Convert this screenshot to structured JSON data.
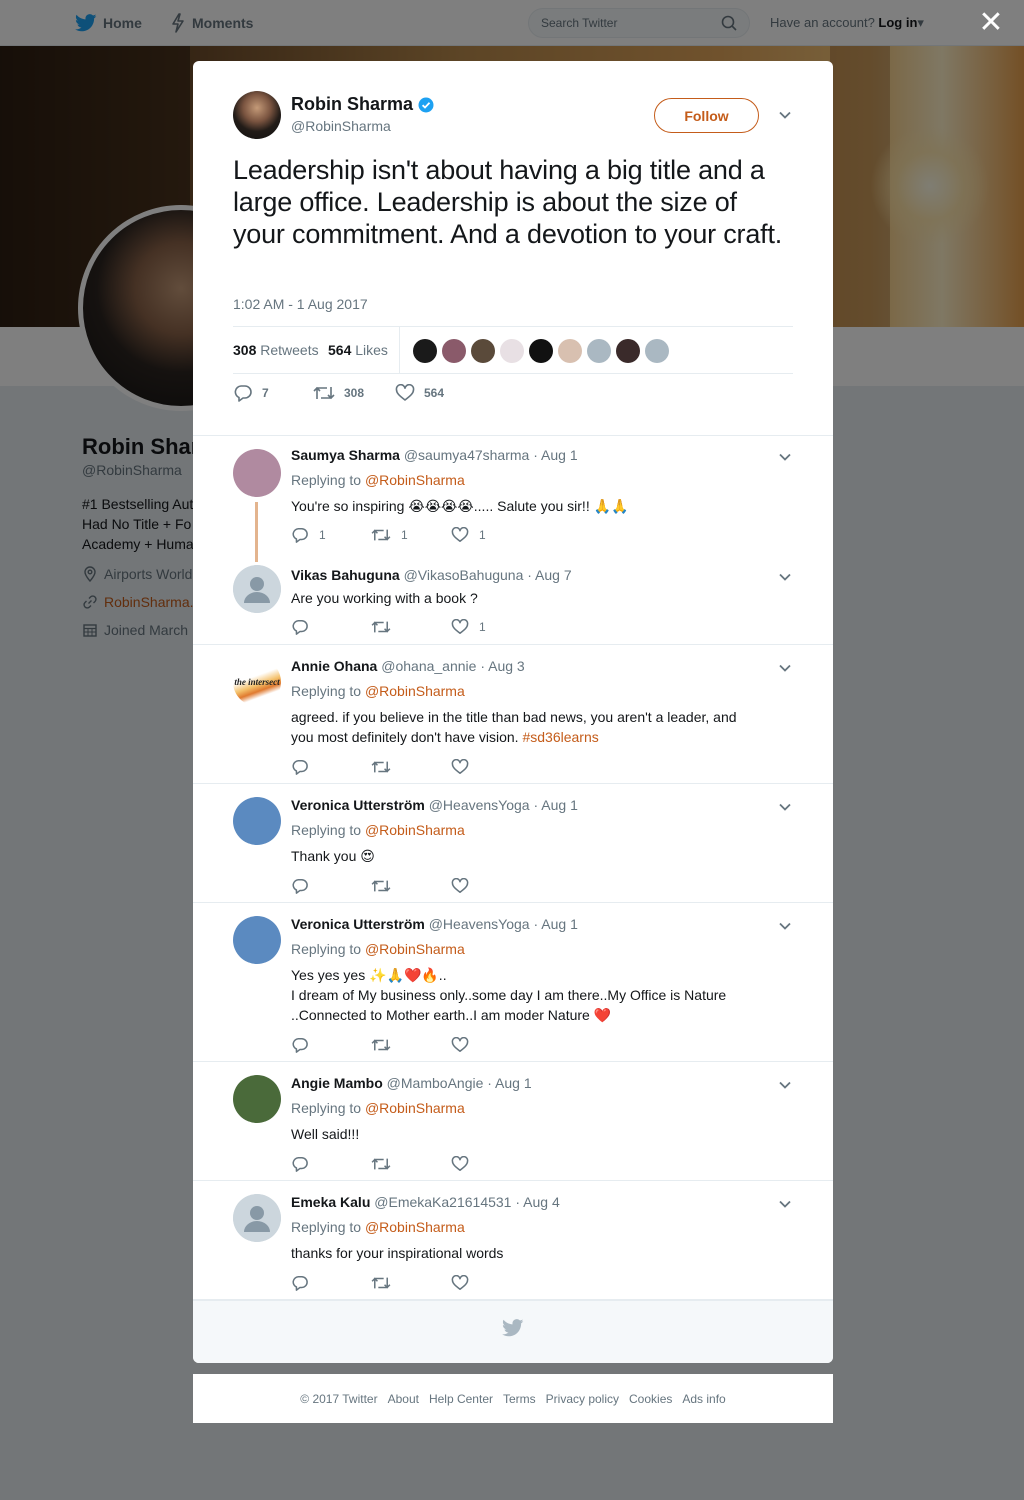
{
  "topnav": {
    "home": "Home",
    "moments": "Moments",
    "search_placeholder": "Search Twitter",
    "account_prompt": "Have an account?",
    "login": "Log in"
  },
  "background_profile": {
    "name": "Robin Shar",
    "handle": "@RobinSharma",
    "bio_lines": [
      "#1 Bestselling Aut",
      "Had No Title + Fo",
      "Academy + Huma"
    ],
    "location": "Airports World",
    "website": "RobinSharma.",
    "joined": "Joined March"
  },
  "main_tweet": {
    "name": "Robin Sharma",
    "handle": "@RobinSharma",
    "follow_label": "Follow",
    "text": "Leadership isn't about having a big title and a large office. Leadership is about the size of your commitment. And a devotion to your craft.",
    "timestamp": "1:02 AM - 1 Aug 2017",
    "retweets_count": "308",
    "retweets_label": "Retweets",
    "likes_count": "564",
    "likes_label": "Likes",
    "likers_colors": [
      "#1a1a1a",
      "#8a5a6a",
      "#5a4a3a",
      "#e8e0e4",
      "#111111",
      "#d8c0b0",
      "#aab8c2",
      "#3a2a2a",
      "#aab8c2"
    ],
    "actions": {
      "replies": "7",
      "retweets": "308",
      "likes": "564"
    }
  },
  "replies": [
    {
      "name": "Saumya Sharma",
      "handle": "@saumya47sharma",
      "date": "· Aug 1",
      "replying_label": "Replying to",
      "replying_to": "@RobinSharma",
      "text": "You're so inspiring 😭😭😭😭..... Salute you sir!! 🙏🙏",
      "reply_count": "1",
      "retweet_count": "1",
      "like_count": "1",
      "avatar_color": "#b08aa0"
    },
    {
      "name": "Vikas Bahuguna",
      "handle": "@VikasoBahuguna",
      "date": "· Aug 7",
      "text": "Are you working with a book ?",
      "reply_count": "",
      "retweet_count": "",
      "like_count": "1",
      "avatar_color": "#ccd6dd"
    },
    {
      "name": "Annie Ohana",
      "handle": "@ohana_annie",
      "date": "· Aug 3",
      "replying_label": "Replying to",
      "replying_to": "@RobinSharma",
      "text": "agreed. if you believe in the title than bad news, you aren't a leader, and you most definitely don't have vision. ",
      "hashtag": "#sd36learns",
      "avatar_color": "#ffffff",
      "avatar_logo": "the intersect"
    },
    {
      "name": "Veronica Utterström",
      "handle": "@HeavensYoga",
      "date": "· Aug 1",
      "replying_label": "Replying to",
      "replying_to": "@RobinSharma",
      "text": "Thank you 😍",
      "avatar_color": "#5b8ac0"
    },
    {
      "name": "Veronica Utterström",
      "handle": "@HeavensYoga",
      "date": "· Aug 1",
      "replying_label": "Replying to",
      "replying_to": "@RobinSharma",
      "text_line1": "Yes yes yes ✨🙏❤️🔥..",
      "text_line2": "I dream of My business only..some day I am there..My Office is Nature ..Connected to Mother earth..I am moder Nature ❤️",
      "avatar_color": "#5b8ac0"
    },
    {
      "name": "Angie Mambo",
      "handle": "@MamboAngie",
      "date": "· Aug 1",
      "replying_label": "Replying to",
      "replying_to": "@RobinSharma",
      "text": "Well said!!!",
      "avatar_color": "#4a6a3a"
    },
    {
      "name": "Emeka Kalu",
      "handle": "@EmekaKa21614531",
      "date": "· Aug 4",
      "replying_label": "Replying to",
      "replying_to": "@RobinSharma",
      "text": "thanks for your inspirational words",
      "avatar_color": "#ccd6dd"
    }
  ],
  "footer": {
    "copyright": "© 2017 Twitter",
    "links": [
      "About",
      "Help Center",
      "Terms",
      "Privacy policy",
      "Cookies",
      "Ads info"
    ]
  },
  "colors": {
    "accent": "#c45c1a",
    "twitter_blue": "#1da1f2",
    "text_secondary": "#66757f"
  }
}
